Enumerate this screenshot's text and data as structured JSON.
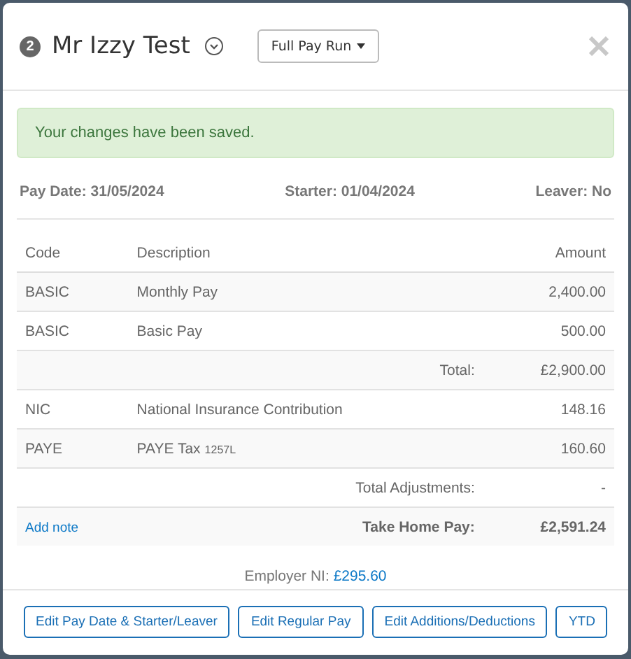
{
  "header": {
    "badge": "2",
    "name": "Mr Izzy Test",
    "run_type": "Full Pay Run"
  },
  "alert": "Your changes have been saved.",
  "info": [
    {
      "label": "Pay Date:",
      "value": "31/05/2024"
    },
    {
      "label": "Starter:",
      "value": "01/04/2024"
    },
    {
      "label": "Leaver:",
      "value": "No"
    }
  ],
  "table": {
    "columns": [
      "Code",
      "Description",
      "Amount"
    ],
    "rows": [
      {
        "kind": "item",
        "code": "BASIC",
        "description": "Monthly Pay",
        "amount": "2,400.00"
      },
      {
        "kind": "item",
        "code": "BASIC",
        "description": "Basic Pay",
        "amount": "500.00"
      },
      {
        "kind": "total",
        "label": "Total:",
        "amount": "£2,900.00"
      },
      {
        "kind": "item",
        "code": "NIC",
        "description": "National Insurance Contribution",
        "amount": "148.16"
      },
      {
        "kind": "item",
        "code": "PAYE",
        "description": "PAYE Tax",
        "note": "1257L",
        "amount": "160.60"
      },
      {
        "kind": "total",
        "label": "Total Adjustments:",
        "amount": "-"
      },
      {
        "kind": "takehome",
        "link": "Add note",
        "label": "Take Home Pay:",
        "amount": "£2,591.24"
      }
    ]
  },
  "employer_ni": {
    "label": "Employer NI:",
    "value": "£295.60"
  },
  "buttons": [
    "Edit Pay Date & Starter/Leaver",
    "Edit Regular Pay",
    "Edit Additions/Deductions",
    "YTD"
  ]
}
